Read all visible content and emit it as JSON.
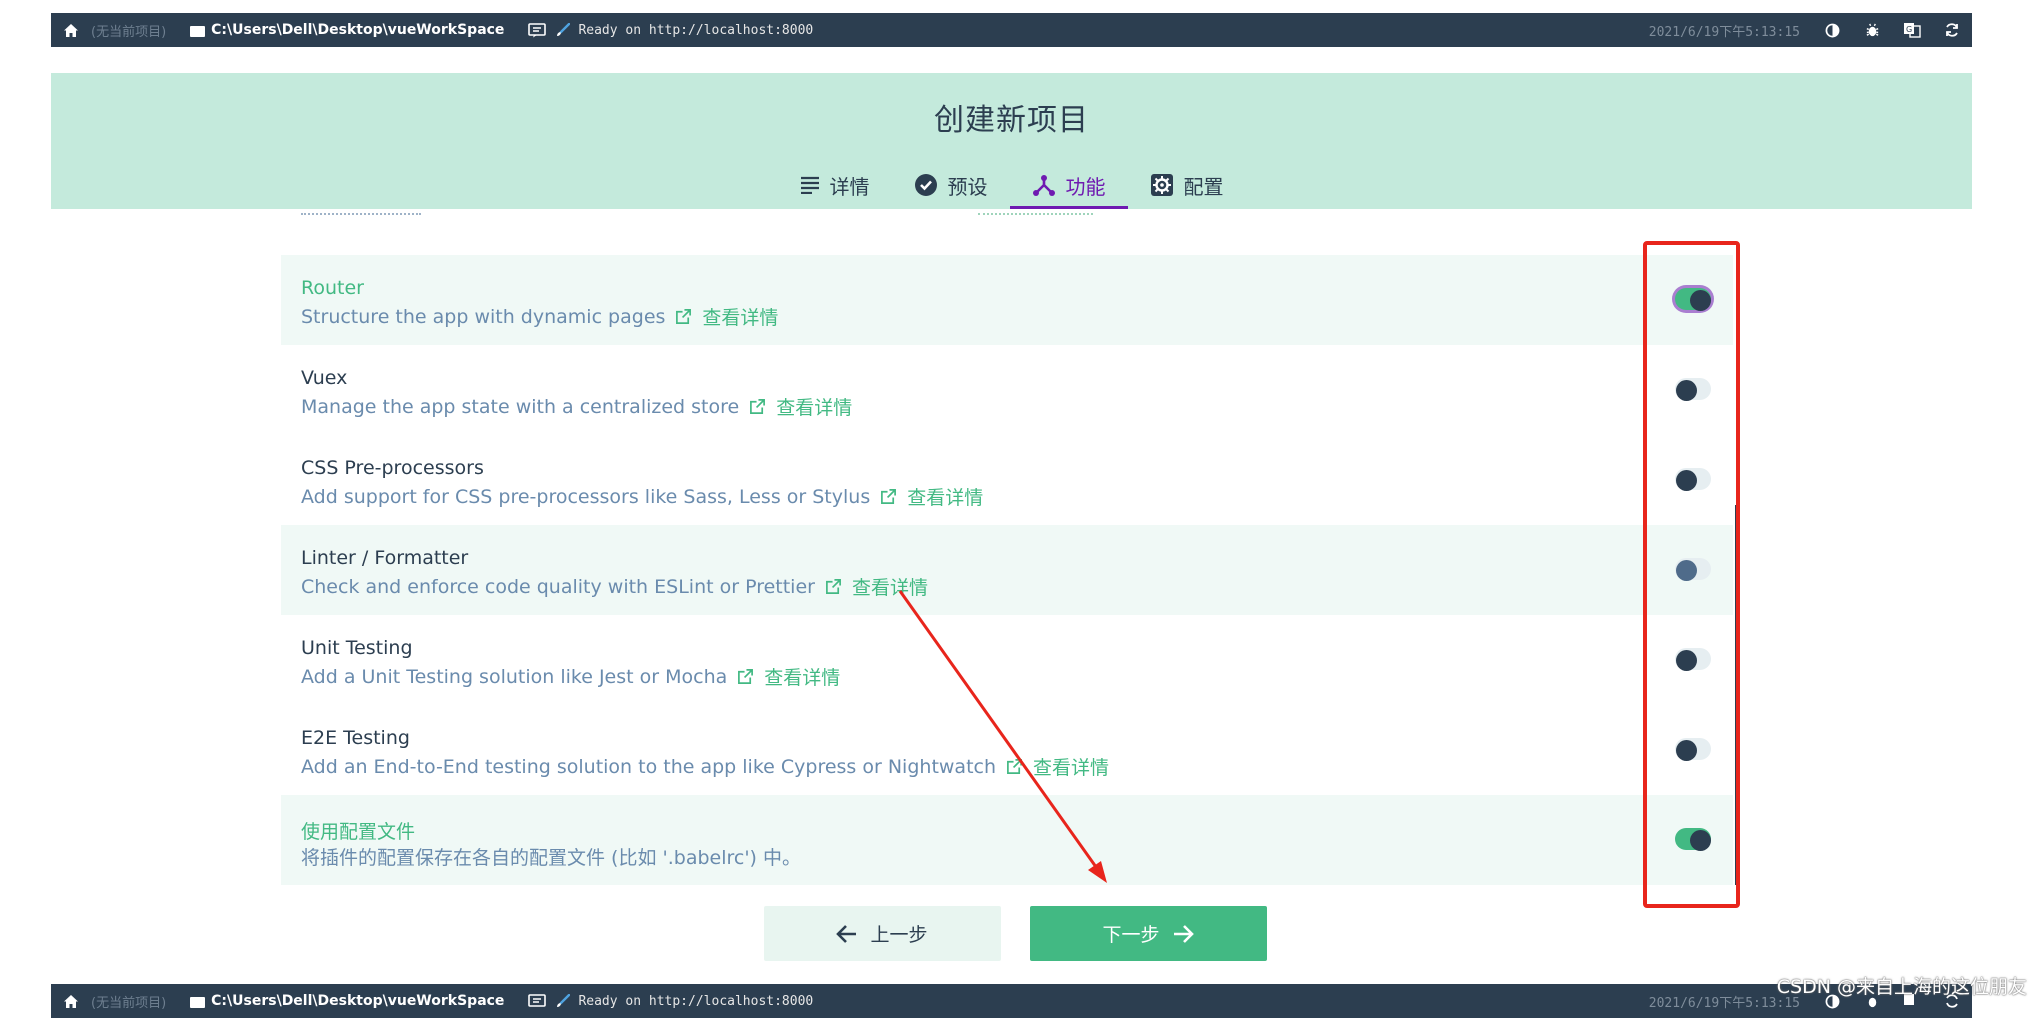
{
  "statusbar": {
    "project": "(无当前项目)",
    "path": "C:\\Users\\Dell\\Desktop\\vueWorkSpace",
    "log": "Ready on http://localhost:8000",
    "datetime": "2021/6/19下午5:13:15",
    "icons": [
      "home-icon",
      "folder-icon",
      "console-icon",
      "brush-icon",
      "contrast-icon",
      "bug-icon",
      "translate-icon",
      "refresh-icon"
    ]
  },
  "header": {
    "title": "创建新项目",
    "tabs": [
      {
        "label": "详情",
        "icon": "list-icon",
        "active": false
      },
      {
        "label": "预设",
        "icon": "check-circle-icon",
        "active": false
      },
      {
        "label": "功能",
        "icon": "fork-icon",
        "active": true
      },
      {
        "label": "配置",
        "icon": "gear-icon",
        "active": false
      }
    ]
  },
  "features": {
    "link_label": "查看详情",
    "items": [
      {
        "name": "Router",
        "desc": "Structure the app with dynamic pages",
        "enabled": true,
        "has_link": true
      },
      {
        "name": "Vuex",
        "desc": "Manage the app state with a centralized store",
        "enabled": false,
        "has_link": true
      },
      {
        "name": "CSS Pre-processors",
        "desc": "Add support for CSS pre-processors like Sass, Less or Stylus",
        "enabled": false,
        "has_link": true
      },
      {
        "name": "Linter / Formatter",
        "desc": "Check and enforce code quality with ESLint or Prettier",
        "enabled": false,
        "has_link": true
      },
      {
        "name": "Unit Testing",
        "desc": "Add a Unit Testing solution like Jest or Mocha",
        "enabled": false,
        "has_link": true
      },
      {
        "name": "E2E Testing",
        "desc": "Add an End-to-End testing solution to the app like Cypress or Nightwatch",
        "enabled": false,
        "has_link": true
      },
      {
        "name": "使用配置文件",
        "desc": "将插件的配置保存在各自的配置文件 (比如 '.babelrc') 中。",
        "enabled": true,
        "has_link": false
      }
    ]
  },
  "buttons": {
    "prev_label": "上一步",
    "next_label": "下一步"
  },
  "watermark": "CSDN @来自上海的这位朋友",
  "colors": {
    "statusbar_bg": "#2c3e50",
    "header_bg": "#c4eadc",
    "accent_green": "#42b983",
    "tab_active": "#6f1ab1",
    "annotation_red": "#e8251c"
  }
}
